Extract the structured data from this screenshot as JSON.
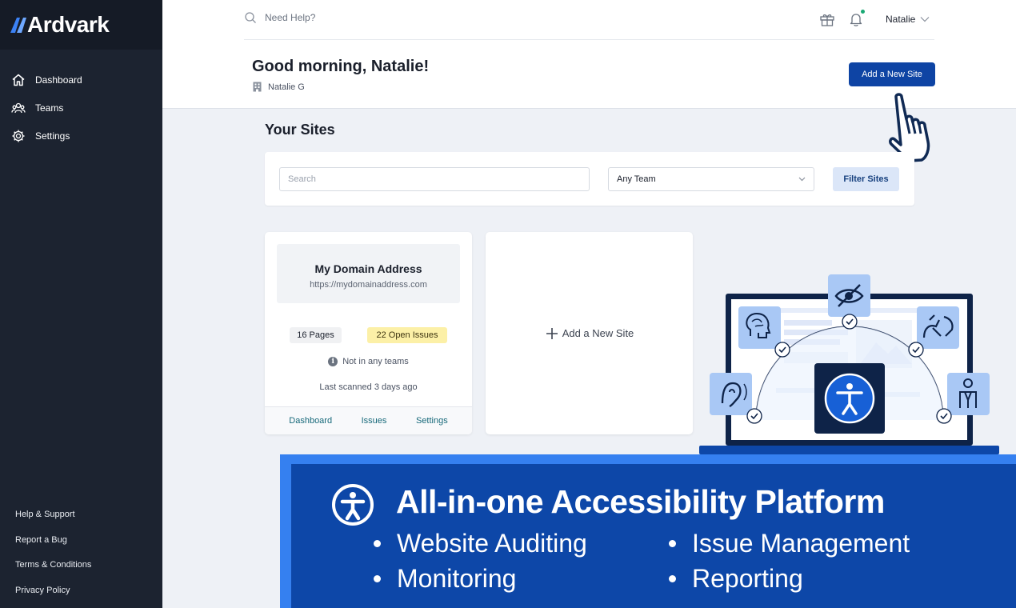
{
  "app": {
    "name": "Ardvark"
  },
  "sidebar": {
    "nav": [
      {
        "label": "Dashboard",
        "icon": "home-icon"
      },
      {
        "label": "Teams",
        "icon": "users-icon"
      },
      {
        "label": "Settings",
        "icon": "gear-icon"
      }
    ],
    "footer": [
      "Help & Support",
      "Report a Bug",
      "Terms & Conditions",
      "Privacy Policy"
    ]
  },
  "header": {
    "search_placeholder": "Need Help?",
    "user_name": "Natalie",
    "greeting": "Good morning, Natalie!",
    "org_name": "Natalie G",
    "add_site_label": "Add a New Site"
  },
  "sites": {
    "title": "Your Sites",
    "search_placeholder": "Search",
    "team_select": "Any Team",
    "filter_label": "Filter Sites",
    "cards": [
      {
        "name": "My Domain Address",
        "url": "https://mydomainaddress.com",
        "pages": "16 Pages",
        "issues": "22 Open Issues",
        "teams": "Not in any teams",
        "scanned": "Last scanned 3 days ago",
        "links": [
          "Dashboard",
          "Issues",
          "Settings"
        ]
      }
    ],
    "add_card_label": "Add a New Site"
  },
  "promo": {
    "title": "All-in-one Accessibility Platform",
    "features": [
      "Website Auditing",
      "Issue Management",
      "Monitoring",
      "Reporting"
    ]
  },
  "colors": {
    "sidebar": "#1c2330",
    "primary": "#0e44a4",
    "banner": "#0d47a8",
    "banner_accent": "#3580f0",
    "issues_badge": "#fcf0a7"
  }
}
